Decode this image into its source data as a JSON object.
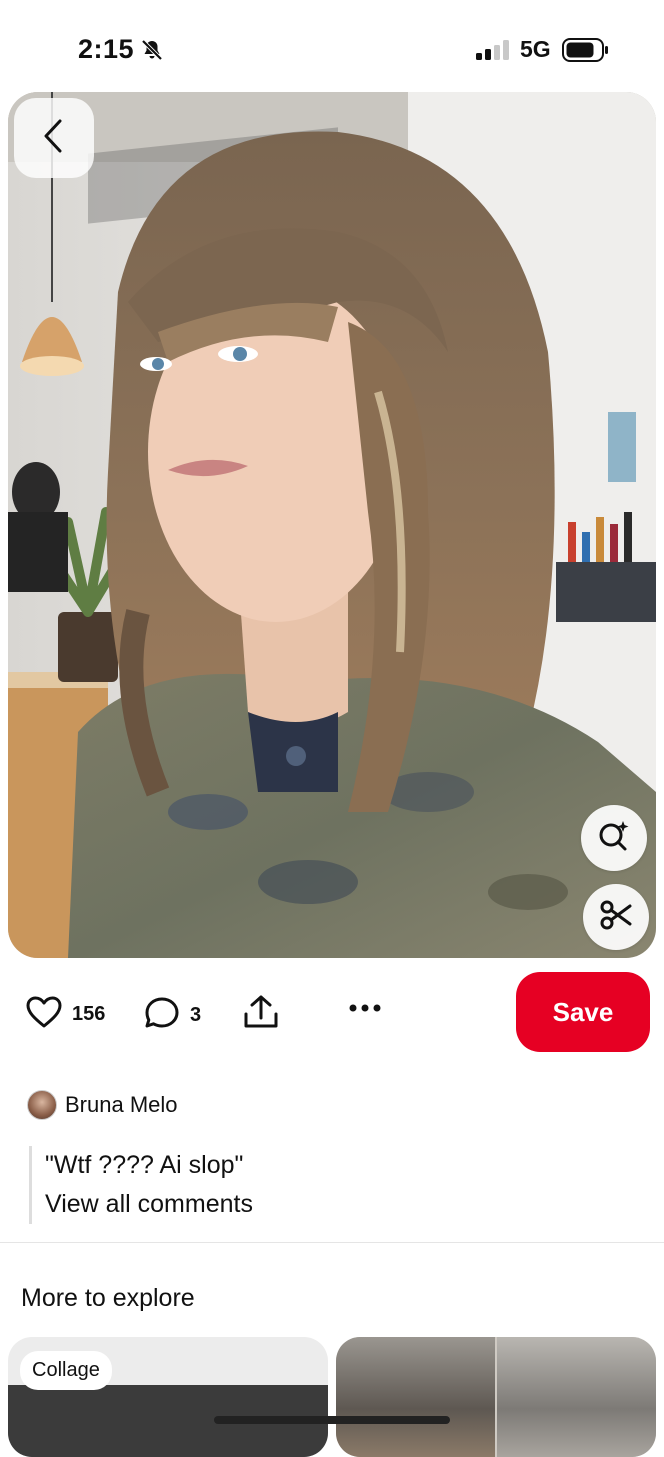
{
  "status_bar": {
    "time": "2:15",
    "network": "5G"
  },
  "pin": {
    "likes": "156",
    "comments": "3",
    "save_label": "Save"
  },
  "comment_preview": {
    "author": "Bruna Melo",
    "text": "\"Wtf ???? Ai slop\"",
    "view_all": "View all comments"
  },
  "explore": {
    "title": "More to explore",
    "collage_label": "Collage"
  },
  "colors": {
    "brand_red": "#e60023"
  },
  "icons": [
    "bell-slash-icon",
    "signal-icon",
    "battery-icon",
    "back-chevron-icon",
    "visual-search-icon",
    "scissors-icon",
    "heart-icon",
    "comment-icon",
    "share-icon",
    "more-icon"
  ]
}
